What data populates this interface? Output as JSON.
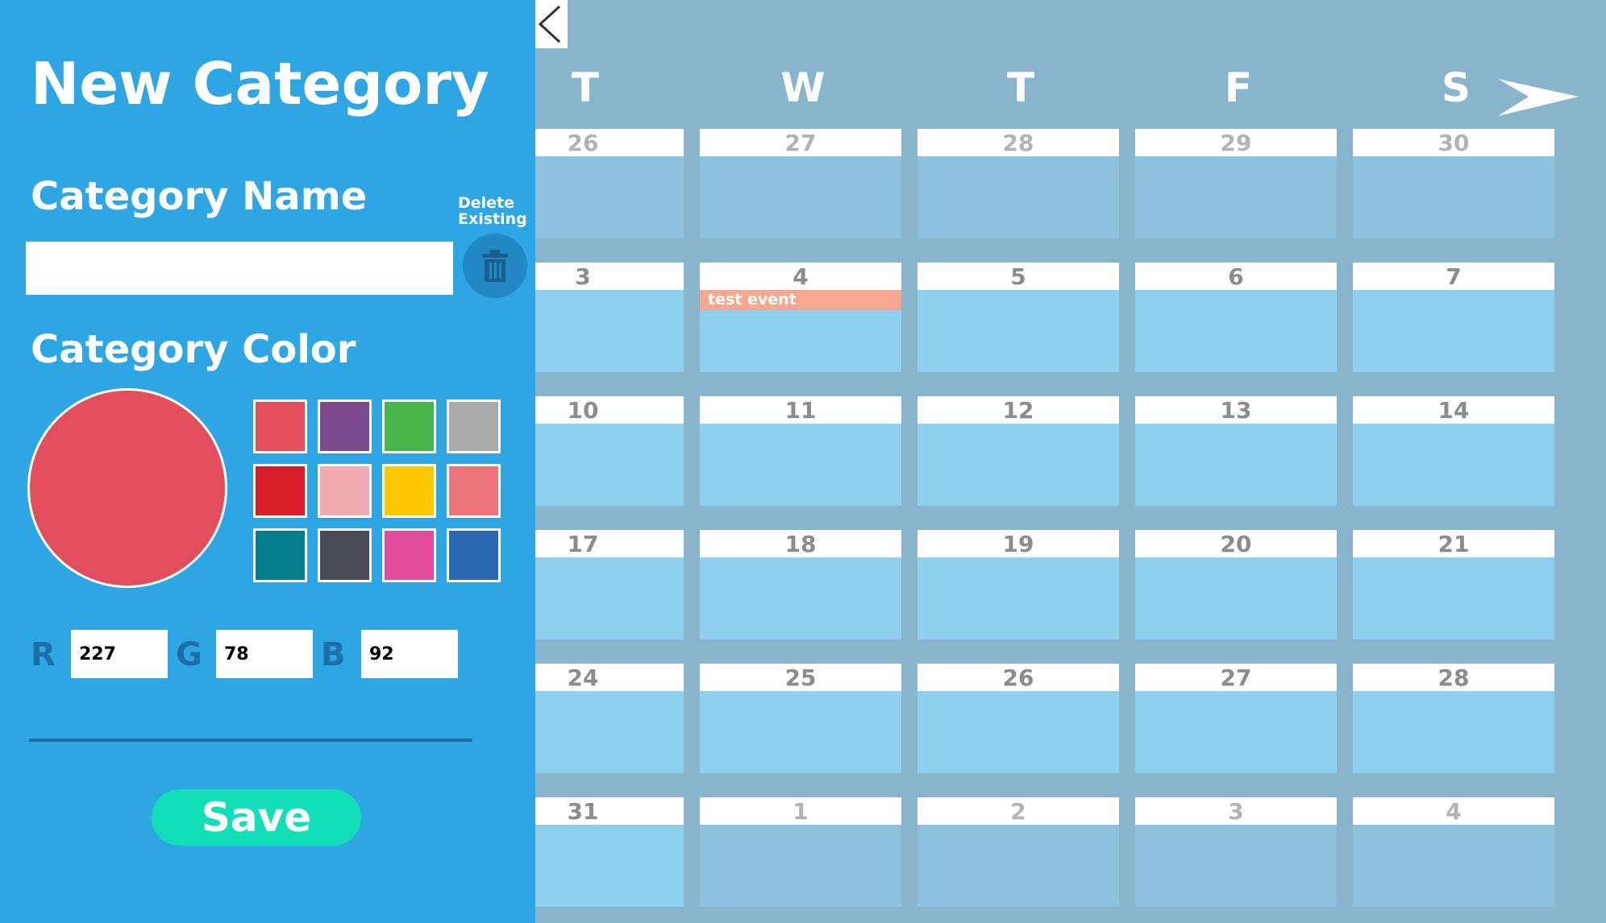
{
  "panel": {
    "title": "New Category",
    "name_label": "Category Name",
    "name_value": "",
    "delete_label": "Delete\nExisting",
    "color_label": "Category Color",
    "selected_color": "#e34e5c",
    "swatches": [
      "#e3505c",
      "#7e4a8e",
      "#47b54a",
      "#aaaaaa",
      "#d81f29",
      "#efabb1",
      "#fec801",
      "#ed7579",
      "#047e8c",
      "#4a4b57",
      "#e14c9b",
      "#2c67b1"
    ],
    "rgb": {
      "r_label": "R",
      "g_label": "G",
      "b_label": "B",
      "r": "227",
      "g": "78",
      "b": "92"
    },
    "save_label": "Save"
  },
  "calendar": {
    "day_headers": [
      "T",
      "W",
      "T",
      "F",
      "S"
    ],
    "weeks": [
      [
        {
          "day": "26",
          "current": false
        },
        {
          "day": "27",
          "current": false
        },
        {
          "day": "28",
          "current": false
        },
        {
          "day": "29",
          "current": false
        },
        {
          "day": "30",
          "current": false
        }
      ],
      [
        {
          "day": "3",
          "current": true
        },
        {
          "day": "4",
          "current": true,
          "event": "test event"
        },
        {
          "day": "5",
          "current": true
        },
        {
          "day": "6",
          "current": true
        },
        {
          "day": "7",
          "current": true
        }
      ],
      [
        {
          "day": "10",
          "current": true
        },
        {
          "day": "11",
          "current": true
        },
        {
          "day": "12",
          "current": true
        },
        {
          "day": "13",
          "current": true
        },
        {
          "day": "14",
          "current": true
        }
      ],
      [
        {
          "day": "17",
          "current": true
        },
        {
          "day": "18",
          "current": true
        },
        {
          "day": "19",
          "current": true
        },
        {
          "day": "20",
          "current": true
        },
        {
          "day": "21",
          "current": true
        }
      ],
      [
        {
          "day": "24",
          "current": true
        },
        {
          "day": "25",
          "current": true
        },
        {
          "day": "26",
          "current": true
        },
        {
          "day": "27",
          "current": true
        },
        {
          "day": "28",
          "current": true
        }
      ],
      [
        {
          "day": "31",
          "current": true
        },
        {
          "day": "1",
          "current": false
        },
        {
          "day": "2",
          "current": false
        },
        {
          "day": "3",
          "current": false
        },
        {
          "day": "4",
          "current": false
        }
      ]
    ],
    "event_color": "#f7a68f"
  }
}
